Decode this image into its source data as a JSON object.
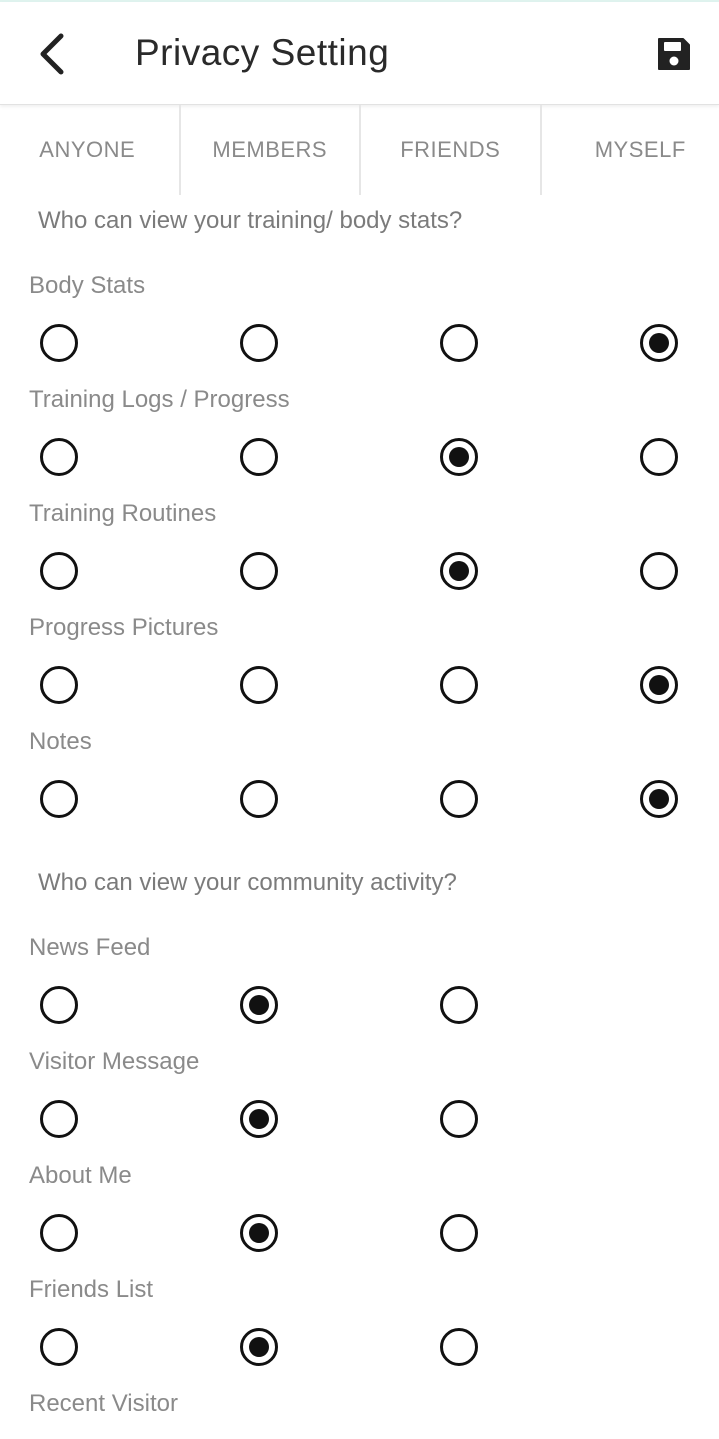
{
  "header": {
    "title": "Privacy Setting",
    "back_icon": "chevron-left-icon",
    "save_icon": "floppy-disk-icon"
  },
  "tabs": [
    "ANYONE",
    "MEMBERS",
    "FRIENDS",
    "MYSELF"
  ],
  "sections": [
    {
      "question": "Who can view your training/ body stats?",
      "rows": [
        {
          "label": "Body Stats",
          "options": 4,
          "selected": 3
        },
        {
          "label": "Training Logs / Progress",
          "options": 4,
          "selected": 2
        },
        {
          "label": "Training Routines",
          "options": 4,
          "selected": 2
        },
        {
          "label": "Progress Pictures",
          "options": 4,
          "selected": 3
        },
        {
          "label": "Notes",
          "options": 4,
          "selected": 3
        }
      ]
    },
    {
      "question": "Who can view your community activity?",
      "rows": [
        {
          "label": "News Feed",
          "options": 3,
          "selected": 1
        },
        {
          "label": "Visitor Message",
          "options": 3,
          "selected": 1
        },
        {
          "label": "About Me",
          "options": 3,
          "selected": 1
        },
        {
          "label": "Friends List",
          "options": 3,
          "selected": 1
        },
        {
          "label": "Recent Visitor",
          "options": 3,
          "selected": null
        }
      ]
    }
  ]
}
